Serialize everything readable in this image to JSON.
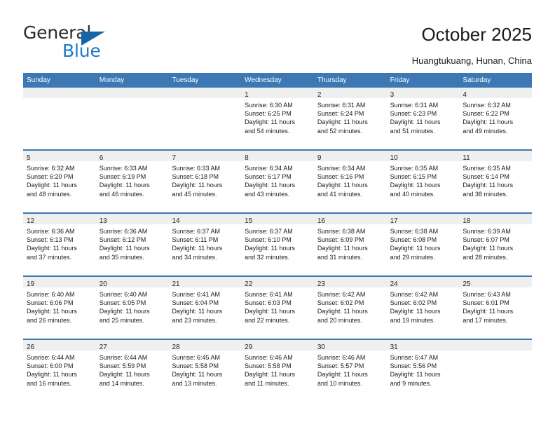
{
  "brand": {
    "name_top": "General",
    "name_bottom": "Blue",
    "triangle_color": "#1565a8",
    "blue_color": "#1f7ac4"
  },
  "header": {
    "title": "October 2025",
    "location": "Huangtukuang, Hunan, China"
  },
  "calendar": {
    "header_bg": "#3b78b4",
    "daynumber_bg": "#efefef",
    "weekdays": [
      "Sunday",
      "Monday",
      "Tuesday",
      "Wednesday",
      "Thursday",
      "Friday",
      "Saturday"
    ],
    "weeks": [
      [
        {
          "day": "",
          "lines": []
        },
        {
          "day": "",
          "lines": []
        },
        {
          "day": "",
          "lines": []
        },
        {
          "day": "1",
          "lines": [
            "Sunrise: 6:30 AM",
            "Sunset: 6:25 PM",
            "Daylight: 11 hours",
            "and 54 minutes."
          ]
        },
        {
          "day": "2",
          "lines": [
            "Sunrise: 6:31 AM",
            "Sunset: 6:24 PM",
            "Daylight: 11 hours",
            "and 52 minutes."
          ]
        },
        {
          "day": "3",
          "lines": [
            "Sunrise: 6:31 AM",
            "Sunset: 6:23 PM",
            "Daylight: 11 hours",
            "and 51 minutes."
          ]
        },
        {
          "day": "4",
          "lines": [
            "Sunrise: 6:32 AM",
            "Sunset: 6:22 PM",
            "Daylight: 11 hours",
            "and 49 minutes."
          ]
        }
      ],
      [
        {
          "day": "5",
          "lines": [
            "Sunrise: 6:32 AM",
            "Sunset: 6:20 PM",
            "Daylight: 11 hours",
            "and 48 minutes."
          ]
        },
        {
          "day": "6",
          "lines": [
            "Sunrise: 6:33 AM",
            "Sunset: 6:19 PM",
            "Daylight: 11 hours",
            "and 46 minutes."
          ]
        },
        {
          "day": "7",
          "lines": [
            "Sunrise: 6:33 AM",
            "Sunset: 6:18 PM",
            "Daylight: 11 hours",
            "and 45 minutes."
          ]
        },
        {
          "day": "8",
          "lines": [
            "Sunrise: 6:34 AM",
            "Sunset: 6:17 PM",
            "Daylight: 11 hours",
            "and 43 minutes."
          ]
        },
        {
          "day": "9",
          "lines": [
            "Sunrise: 6:34 AM",
            "Sunset: 6:16 PM",
            "Daylight: 11 hours",
            "and 41 minutes."
          ]
        },
        {
          "day": "10",
          "lines": [
            "Sunrise: 6:35 AM",
            "Sunset: 6:15 PM",
            "Daylight: 11 hours",
            "and 40 minutes."
          ]
        },
        {
          "day": "11",
          "lines": [
            "Sunrise: 6:35 AM",
            "Sunset: 6:14 PM",
            "Daylight: 11 hours",
            "and 38 minutes."
          ]
        }
      ],
      [
        {
          "day": "12",
          "lines": [
            "Sunrise: 6:36 AM",
            "Sunset: 6:13 PM",
            "Daylight: 11 hours",
            "and 37 minutes."
          ]
        },
        {
          "day": "13",
          "lines": [
            "Sunrise: 6:36 AM",
            "Sunset: 6:12 PM",
            "Daylight: 11 hours",
            "and 35 minutes."
          ]
        },
        {
          "day": "14",
          "lines": [
            "Sunrise: 6:37 AM",
            "Sunset: 6:11 PM",
            "Daylight: 11 hours",
            "and 34 minutes."
          ]
        },
        {
          "day": "15",
          "lines": [
            "Sunrise: 6:37 AM",
            "Sunset: 6:10 PM",
            "Daylight: 11 hours",
            "and 32 minutes."
          ]
        },
        {
          "day": "16",
          "lines": [
            "Sunrise: 6:38 AM",
            "Sunset: 6:09 PM",
            "Daylight: 11 hours",
            "and 31 minutes."
          ]
        },
        {
          "day": "17",
          "lines": [
            "Sunrise: 6:38 AM",
            "Sunset: 6:08 PM",
            "Daylight: 11 hours",
            "and 29 minutes."
          ]
        },
        {
          "day": "18",
          "lines": [
            "Sunrise: 6:39 AM",
            "Sunset: 6:07 PM",
            "Daylight: 11 hours",
            "and 28 minutes."
          ]
        }
      ],
      [
        {
          "day": "19",
          "lines": [
            "Sunrise: 6:40 AM",
            "Sunset: 6:06 PM",
            "Daylight: 11 hours",
            "and 26 minutes."
          ]
        },
        {
          "day": "20",
          "lines": [
            "Sunrise: 6:40 AM",
            "Sunset: 6:05 PM",
            "Daylight: 11 hours",
            "and 25 minutes."
          ]
        },
        {
          "day": "21",
          "lines": [
            "Sunrise: 6:41 AM",
            "Sunset: 6:04 PM",
            "Daylight: 11 hours",
            "and 23 minutes."
          ]
        },
        {
          "day": "22",
          "lines": [
            "Sunrise: 6:41 AM",
            "Sunset: 6:03 PM",
            "Daylight: 11 hours",
            "and 22 minutes."
          ]
        },
        {
          "day": "23",
          "lines": [
            "Sunrise: 6:42 AM",
            "Sunset: 6:02 PM",
            "Daylight: 11 hours",
            "and 20 minutes."
          ]
        },
        {
          "day": "24",
          "lines": [
            "Sunrise: 6:42 AM",
            "Sunset: 6:02 PM",
            "Daylight: 11 hours",
            "and 19 minutes."
          ]
        },
        {
          "day": "25",
          "lines": [
            "Sunrise: 6:43 AM",
            "Sunset: 6:01 PM",
            "Daylight: 11 hours",
            "and 17 minutes."
          ]
        }
      ],
      [
        {
          "day": "26",
          "lines": [
            "Sunrise: 6:44 AM",
            "Sunset: 6:00 PM",
            "Daylight: 11 hours",
            "and 16 minutes."
          ]
        },
        {
          "day": "27",
          "lines": [
            "Sunrise: 6:44 AM",
            "Sunset: 5:59 PM",
            "Daylight: 11 hours",
            "and 14 minutes."
          ]
        },
        {
          "day": "28",
          "lines": [
            "Sunrise: 6:45 AM",
            "Sunset: 5:58 PM",
            "Daylight: 11 hours",
            "and 13 minutes."
          ]
        },
        {
          "day": "29",
          "lines": [
            "Sunrise: 6:46 AM",
            "Sunset: 5:58 PM",
            "Daylight: 11 hours",
            "and 11 minutes."
          ]
        },
        {
          "day": "30",
          "lines": [
            "Sunrise: 6:46 AM",
            "Sunset: 5:57 PM",
            "Daylight: 11 hours",
            "and 10 minutes."
          ]
        },
        {
          "day": "31",
          "lines": [
            "Sunrise: 6:47 AM",
            "Sunset: 5:56 PM",
            "Daylight: 11 hours",
            "and 9 minutes."
          ]
        },
        {
          "day": "",
          "lines": []
        }
      ]
    ]
  }
}
